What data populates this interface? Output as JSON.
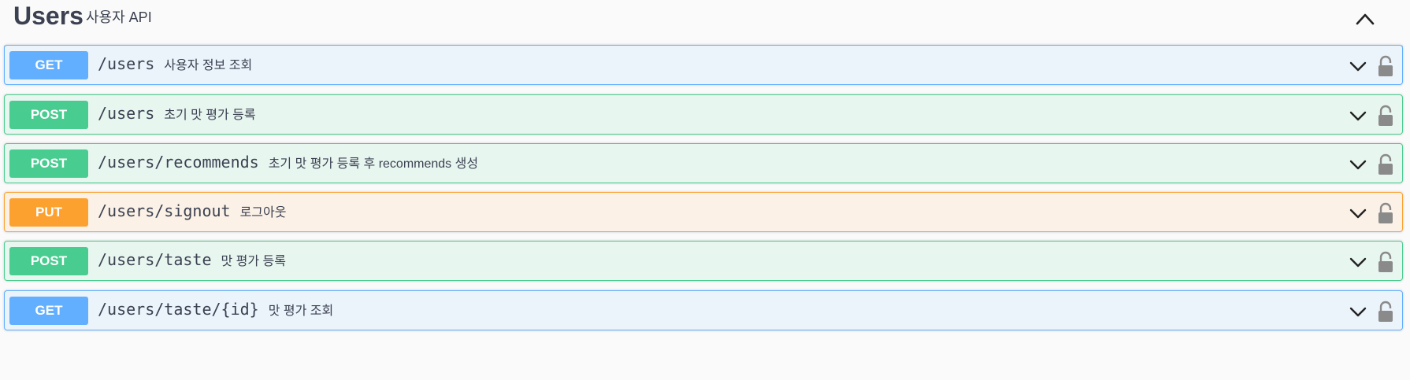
{
  "section": {
    "title": "Users",
    "description": "사용자 API",
    "toggle_icon": "chevron-up-icon"
  },
  "colors": {
    "get": "#61affe",
    "post": "#49cc90",
    "put": "#fca130",
    "text": "#3b4151"
  },
  "operations": [
    {
      "method": "GET",
      "path": "/users",
      "summary": "사용자 정보 조회"
    },
    {
      "method": "POST",
      "path": "/users",
      "summary": "초기 맛 평가 등록"
    },
    {
      "method": "POST",
      "path": "/users/recommends",
      "summary": "초기 맛 평가 등록 후 recommends 생성"
    },
    {
      "method": "PUT",
      "path": "/users/signout",
      "summary": "로그아웃"
    },
    {
      "method": "POST",
      "path": "/users/taste",
      "summary": "맛 평가 등록"
    },
    {
      "method": "GET",
      "path": "/users/taste/{id}",
      "summary": "맛 평가 조회"
    }
  ],
  "icons": {
    "expand": "chevron-down-icon",
    "auth": "lock-icon"
  }
}
